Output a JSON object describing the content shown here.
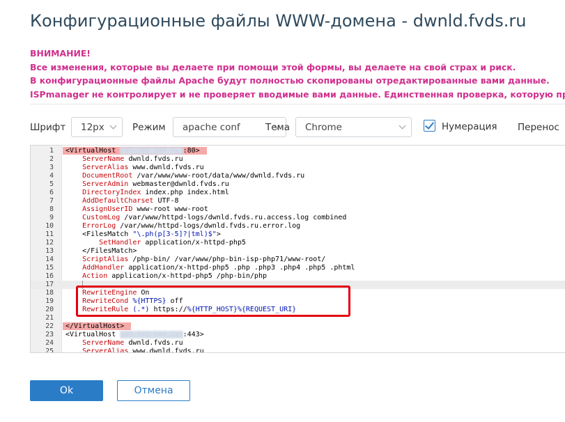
{
  "dialog": {
    "title": "Конфигурационные файлы WWW-домена - dwnld.fvds.ru"
  },
  "warning": {
    "heading": "ВНИМАНИЕ!",
    "lines": [
      "Все изменения, которые вы делаете при помощи этой формы, вы делаете на свой страх и риск.",
      "В конфигурационные файлы Apache будут полностью скопированы отредактированные вами данные.",
      "ISPmanager не контролирует и не проверяет вводимые вами данные. Единственная проверка, которую произ"
    ]
  },
  "toolbar": {
    "font_label": "Шрифт",
    "font_value": "12px",
    "mode_label": "Режим",
    "mode_value": "apache conf",
    "theme_label": "Тема",
    "theme_value": "Chrome",
    "numbering_label": "Нумерация",
    "numbering_checked": true,
    "wrap_label": "Перенос"
  },
  "editor": {
    "lines": [
      {
        "n": "1",
        "parts": [
          [
            "tag",
            "<VirtualHost "
          ],
          [
            "blur",
            "185.162.144.123"
          ],
          [
            "tag",
            ":80>"
          ]
        ],
        "highlight": true
      },
      {
        "n": "2",
        "parts": [
          [
            "ind",
            "    "
          ],
          [
            "kw",
            "ServerName"
          ],
          [
            "tag",
            " dwnld.fvds.ru"
          ]
        ]
      },
      {
        "n": "3",
        "parts": [
          [
            "ind",
            "    "
          ],
          [
            "kw",
            "ServerAlias"
          ],
          [
            "tag",
            " www.dwnld.fvds.ru"
          ]
        ]
      },
      {
        "n": "4",
        "parts": [
          [
            "ind",
            "    "
          ],
          [
            "kw",
            "DocumentRoot"
          ],
          [
            "tag",
            " /var/www/www-root/data/www/dwnld.fvds.ru"
          ]
        ]
      },
      {
        "n": "5",
        "parts": [
          [
            "ind",
            "    "
          ],
          [
            "kw",
            "ServerAdmin"
          ],
          [
            "tag",
            " webmaster@dwnld.fvds.ru"
          ]
        ]
      },
      {
        "n": "6",
        "parts": [
          [
            "ind",
            "    "
          ],
          [
            "kw",
            "DirectoryIndex"
          ],
          [
            "tag",
            " index.php index.html"
          ]
        ]
      },
      {
        "n": "7",
        "parts": [
          [
            "ind",
            "    "
          ],
          [
            "kw",
            "AddDefaultCharset"
          ],
          [
            "tag",
            " UTF-8"
          ]
        ]
      },
      {
        "n": "8",
        "parts": [
          [
            "ind",
            "    "
          ],
          [
            "kw",
            "AssignUserID"
          ],
          [
            "tag",
            " www-root www-root"
          ]
        ]
      },
      {
        "n": "9",
        "parts": [
          [
            "ind",
            "    "
          ],
          [
            "kw",
            "CustomLog"
          ],
          [
            "tag",
            " /var/www/httpd-logs/dwnld.fvds.ru.access.log combined"
          ]
        ]
      },
      {
        "n": "10",
        "parts": [
          [
            "ind",
            "    "
          ],
          [
            "kw",
            "ErrorLog"
          ],
          [
            "tag",
            " /var/www/httpd-logs/dwnld.fvds.ru.error.log"
          ]
        ]
      },
      {
        "n": "11",
        "parts": [
          [
            "ind",
            "    "
          ],
          [
            "tag",
            "<FilesMatch "
          ],
          [
            "str",
            "\"\\.ph(p[3-5]?|tml)$\""
          ],
          [
            "tag",
            ">"
          ]
        ]
      },
      {
        "n": "12",
        "parts": [
          [
            "ind",
            "        "
          ],
          [
            "kw",
            "SetHandler"
          ],
          [
            "tag",
            " application/x-httpd-php5"
          ]
        ]
      },
      {
        "n": "13",
        "parts": [
          [
            "ind",
            "    "
          ],
          [
            "tag",
            "</FilesMatch>"
          ]
        ]
      },
      {
        "n": "14",
        "parts": [
          [
            "ind",
            "    "
          ],
          [
            "kw",
            "ScriptAlias"
          ],
          [
            "tag",
            " /php-bin/ /var/www/php-bin-isp-php71/www-root/"
          ]
        ]
      },
      {
        "n": "15",
        "parts": [
          [
            "ind",
            "    "
          ],
          [
            "kw",
            "AddHandler"
          ],
          [
            "tag",
            " application/x-httpd-php5 .php .php3 .php4 .php5 .phtml"
          ]
        ]
      },
      {
        "n": "16",
        "parts": [
          [
            "ind",
            "    "
          ],
          [
            "kw",
            "Action"
          ],
          [
            "tag",
            " application/x-httpd-php5 /php-bin/php"
          ]
        ]
      },
      {
        "n": "17",
        "parts": [
          [
            "ind",
            "    "
          ],
          [
            "cursor",
            ""
          ]
        ],
        "active": true
      },
      {
        "n": "18",
        "parts": [
          [
            "ind",
            "    "
          ],
          [
            "kw",
            "RewriteEngine"
          ],
          [
            "tag",
            " On"
          ]
        ]
      },
      {
        "n": "19",
        "parts": [
          [
            "ind",
            "    "
          ],
          [
            "kw",
            "RewriteCond"
          ],
          [
            "str",
            " %{HTTPS}"
          ],
          [
            "tag",
            " off"
          ]
        ]
      },
      {
        "n": "20",
        "parts": [
          [
            "ind",
            "    "
          ],
          [
            "kw",
            "RewriteRule"
          ],
          [
            "str",
            " (.*)"
          ],
          [
            "tag",
            " https://"
          ],
          [
            "str",
            "%{HTTP_HOST}%{REQUEST_URI}"
          ]
        ]
      },
      {
        "n": "21",
        "parts": []
      },
      {
        "n": "22",
        "parts": [
          [
            "tag",
            "</VirtualHost>"
          ]
        ],
        "highlight": true
      },
      {
        "n": "23",
        "parts": [
          [
            "tag",
            "<VirtualHost "
          ],
          [
            "blur",
            "185.162.144.123"
          ],
          [
            "tag",
            ":443>"
          ]
        ]
      },
      {
        "n": "24",
        "parts": [
          [
            "ind",
            "    "
          ],
          [
            "kw",
            "ServerName"
          ],
          [
            "tag",
            " dwnld.fvds.ru"
          ]
        ]
      },
      {
        "n": "25",
        "parts": [
          [
            "ind",
            "    "
          ],
          [
            "kw",
            "ServerAlias"
          ],
          [
            "tag",
            " www.dwnld.fvds.ru"
          ]
        ]
      }
    ]
  },
  "buttons": {
    "ok_label": "Ok",
    "cancel_label": "Отмена"
  },
  "colors": {
    "title": "#2f4a5e",
    "warning": "#d0308e",
    "accent": "#2a7cc7",
    "keyword": "#c5060b",
    "string": "#0015b0",
    "highlight_bg": "#f6a9a9",
    "annotation_box": "#e3000f"
  }
}
